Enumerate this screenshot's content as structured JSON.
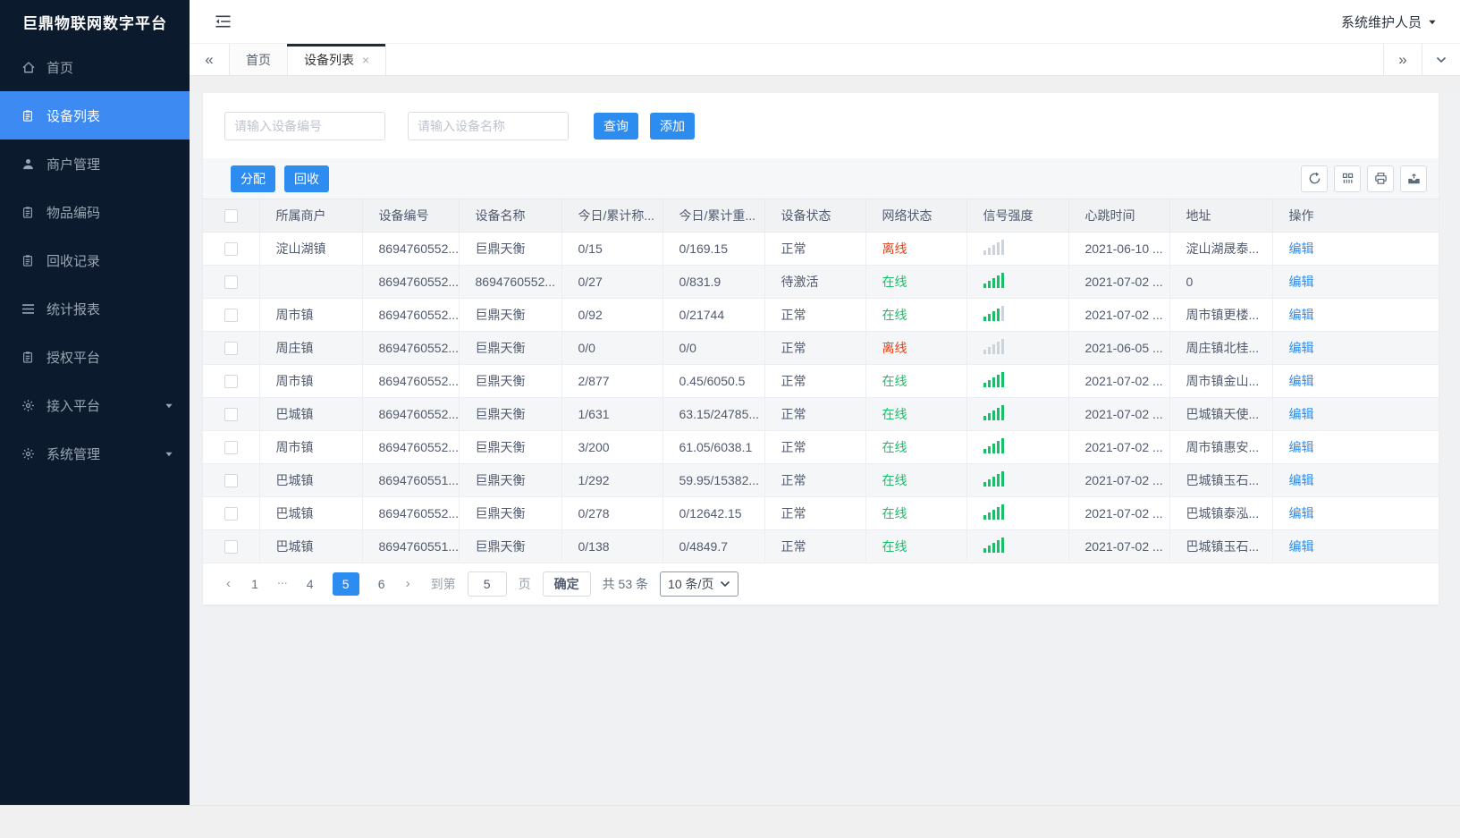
{
  "brand": {
    "title": "巨鼎物联网数字平台"
  },
  "topbar": {
    "user_label": "系统维护人员"
  },
  "colors": {
    "primary": "#2d8cf0",
    "menu_active": "#3d8af2",
    "sidebar_bg": "#0b1a2c",
    "online": "#19be6b",
    "offline": "#ed4014",
    "link": "#2d8cf0"
  },
  "sidebar": {
    "items": [
      {
        "label": "首页",
        "icon": "home-icon",
        "active": false,
        "expandable": false
      },
      {
        "label": "设备列表",
        "icon": "clipboard-icon",
        "active": true,
        "expandable": false
      },
      {
        "label": "商户管理",
        "icon": "user-icon",
        "active": false,
        "expandable": false
      },
      {
        "label": "物品编码",
        "icon": "clipboard-icon",
        "active": false,
        "expandable": false
      },
      {
        "label": "回收记录",
        "icon": "clipboard-icon",
        "active": false,
        "expandable": false
      },
      {
        "label": "统计报表",
        "icon": "menu-lines-icon",
        "active": false,
        "expandable": false
      },
      {
        "label": "授权平台",
        "icon": "clipboard-icon",
        "active": false,
        "expandable": false
      },
      {
        "label": "接入平台",
        "icon": "gear-icon",
        "active": false,
        "expandable": true
      },
      {
        "label": "系统管理",
        "icon": "gear-icon",
        "active": false,
        "expandable": true
      }
    ]
  },
  "tabs": {
    "items": [
      {
        "label": "首页",
        "active": false,
        "closable": false
      },
      {
        "label": "设备列表",
        "active": true,
        "closable": true
      }
    ]
  },
  "search": {
    "device_no_placeholder": "请输入设备编号",
    "device_name_placeholder": "请输入设备名称",
    "query_button": "查询",
    "add_button": "添加"
  },
  "toolbar": {
    "assign_button": "分配",
    "recycle_button": "回收",
    "icons": [
      "refresh-icon",
      "columns-icon",
      "print-icon",
      "export-icon"
    ]
  },
  "table": {
    "columns": [
      "所属商户",
      "设备编号",
      "设备名称",
      "今日/累计称...",
      "今日/累计重...",
      "设备状态",
      "网络状态",
      "信号强度",
      "心跳时间",
      "地址",
      "操作"
    ],
    "action_label": "编辑",
    "rows": [
      {
        "merchant": "淀山湖镇",
        "device_no": "8694760552...",
        "device_name": "巨鼎天衡",
        "today_count": "0/15",
        "today_weight": "0/169.15",
        "device_status": "正常",
        "network_status": "离线",
        "online": false,
        "signal": 0,
        "heartbeat": "2021-06-10 ...",
        "address": "淀山湖晟泰..."
      },
      {
        "merchant": "",
        "device_no": "8694760552...",
        "device_name": "8694760552...",
        "today_count": "0/27",
        "today_weight": "0/831.9",
        "device_status": "待激活",
        "network_status": "在线",
        "online": true,
        "signal": 5,
        "heartbeat": "2021-07-02 ...",
        "address": "0"
      },
      {
        "merchant": "周市镇",
        "device_no": "8694760552...",
        "device_name": "巨鼎天衡",
        "today_count": "0/92",
        "today_weight": "0/21744",
        "device_status": "正常",
        "network_status": "在线",
        "online": true,
        "signal": 4,
        "heartbeat": "2021-07-02 ...",
        "address": "周市镇更楼..."
      },
      {
        "merchant": "周庄镇",
        "device_no": "8694760552...",
        "device_name": "巨鼎天衡",
        "today_count": "0/0",
        "today_weight": "0/0",
        "device_status": "正常",
        "network_status": "离线",
        "online": false,
        "signal": 0,
        "heartbeat": "2021-06-05 ...",
        "address": "周庄镇北桂..."
      },
      {
        "merchant": "周市镇",
        "device_no": "8694760552...",
        "device_name": "巨鼎天衡",
        "today_count": "2/877",
        "today_weight": "0.45/6050.5",
        "device_status": "正常",
        "network_status": "在线",
        "online": true,
        "signal": 5,
        "heartbeat": "2021-07-02 ...",
        "address": "周市镇金山..."
      },
      {
        "merchant": "巴城镇",
        "device_no": "8694760552...",
        "device_name": "巨鼎天衡",
        "today_count": "1/631",
        "today_weight": "63.15/24785...",
        "device_status": "正常",
        "network_status": "在线",
        "online": true,
        "signal": 5,
        "heartbeat": "2021-07-02 ...",
        "address": "巴城镇天使..."
      },
      {
        "merchant": "周市镇",
        "device_no": "8694760552...",
        "device_name": "巨鼎天衡",
        "today_count": "3/200",
        "today_weight": "61.05/6038.1",
        "device_status": "正常",
        "network_status": "在线",
        "online": true,
        "signal": 5,
        "heartbeat": "2021-07-02 ...",
        "address": "周市镇惠安..."
      },
      {
        "merchant": "巴城镇",
        "device_no": "8694760551...",
        "device_name": "巨鼎天衡",
        "today_count": "1/292",
        "today_weight": "59.95/15382...",
        "device_status": "正常",
        "network_status": "在线",
        "online": true,
        "signal": 5,
        "heartbeat": "2021-07-02 ...",
        "address": "巴城镇玉石..."
      },
      {
        "merchant": "巴城镇",
        "device_no": "8694760552...",
        "device_name": "巨鼎天衡",
        "today_count": "0/278",
        "today_weight": "0/12642.15",
        "device_status": "正常",
        "network_status": "在线",
        "online": true,
        "signal": 5,
        "heartbeat": "2021-07-02 ...",
        "address": "巴城镇泰泓..."
      },
      {
        "merchant": "巴城镇",
        "device_no": "8694760551...",
        "device_name": "巨鼎天衡",
        "today_count": "0/138",
        "today_weight": "0/4849.7",
        "device_status": "正常",
        "network_status": "在线",
        "online": true,
        "signal": 5,
        "heartbeat": "2021-07-02 ...",
        "address": "巴城镇玉石..."
      }
    ]
  },
  "pagination": {
    "pages": [
      "1",
      "...",
      "4",
      "5",
      "6"
    ],
    "active_page": "5",
    "prev_label": "‹",
    "next_label": "›",
    "goto_label": "到第",
    "goto_value": "5",
    "page_suffix": "页",
    "confirm_button": "确定",
    "total_label": "共 53 条",
    "page_size": "10 条/页"
  }
}
